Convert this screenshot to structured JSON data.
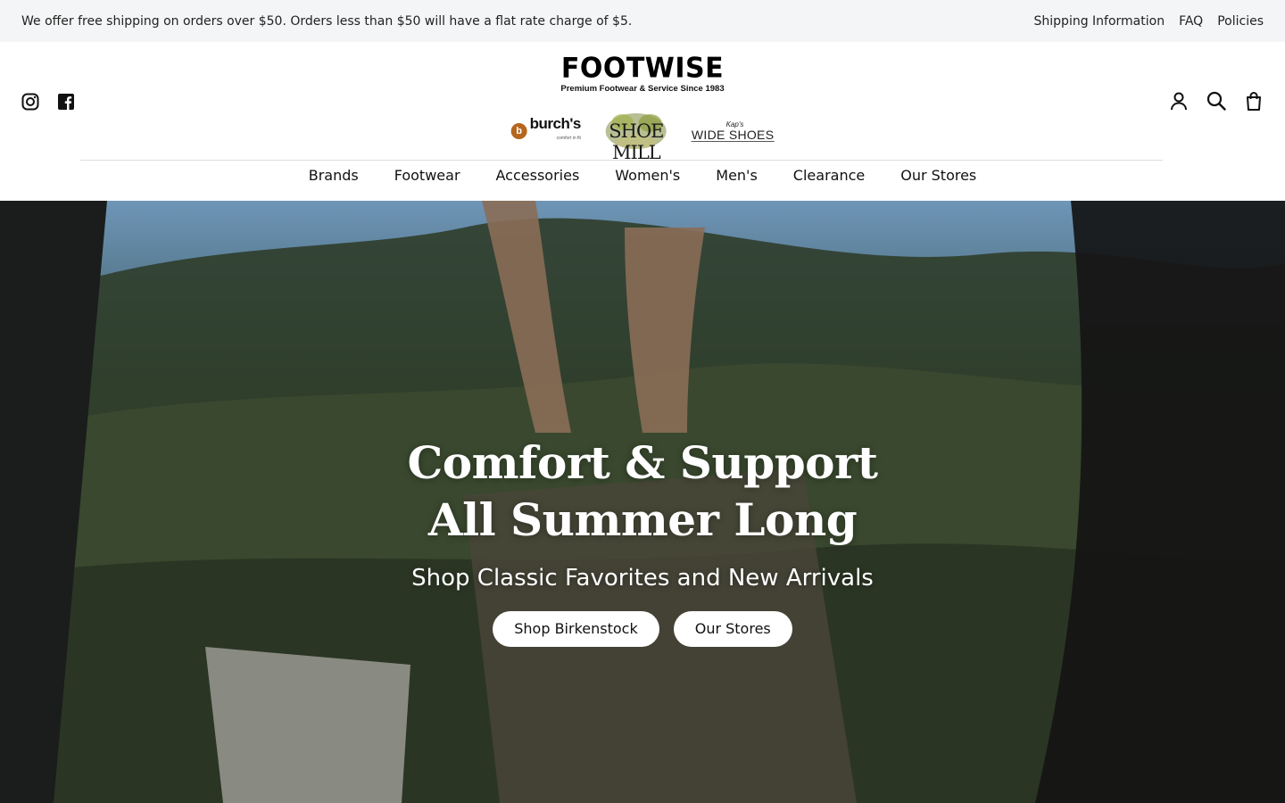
{
  "announcement": {
    "text": "We offer free shipping on orders over $50. Orders less than $50 will have a flat rate charge of $5.",
    "links": [
      "Shipping Information",
      "FAQ",
      "Policies"
    ]
  },
  "header": {
    "logo": {
      "wordmark": "FOOTWISE",
      "tagline": "Premium Footwear & Service Since 1983"
    },
    "sublogos": {
      "burchs": "burch's",
      "burchs_small": "comfort in fit",
      "shoemill": "SHOE MILL",
      "wideshoes_top": "Kap's",
      "wideshoes_main": "WIDE SHOES"
    },
    "social_icons": [
      "instagram-icon",
      "facebook-icon"
    ],
    "utility_icons": [
      "account-icon",
      "search-icon",
      "cart-icon"
    ]
  },
  "nav": {
    "items": [
      "Brands",
      "Footwear",
      "Accessories",
      "Women's",
      "Men's",
      "Clearance",
      "Our Stores"
    ]
  },
  "hero": {
    "title": "Comfort & Support All Summer Long",
    "subtitle": "Shop Classic Favorites and New Arrivals",
    "buttons": [
      "Shop Birkenstock",
      "Our Stores"
    ]
  }
}
